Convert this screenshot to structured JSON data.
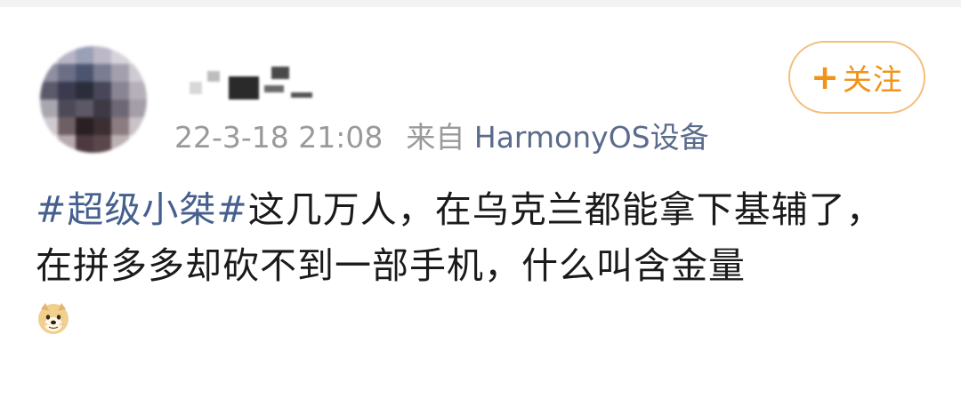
{
  "post": {
    "meta": {
      "timestamp": "22-3-18 21:08",
      "source_prefix": "来自",
      "source_device": "HarmonyOS设备"
    },
    "follow_button": {
      "icon": "plus-icon",
      "label": "关注"
    },
    "content": {
      "hashtag": "#超级小桀#",
      "text": "这几万人，在乌克兰都能拿下基辅了，在拼多多却砍不到一部手机，什么叫含金量",
      "emoji": "doge-emoji"
    }
  },
  "colors": {
    "hashtag": "#45608f",
    "follow_accent": "#f29216",
    "follow_border": "#f2c07c",
    "meta_text": "#9a9a9a",
    "source_text": "#5b6b8c"
  }
}
